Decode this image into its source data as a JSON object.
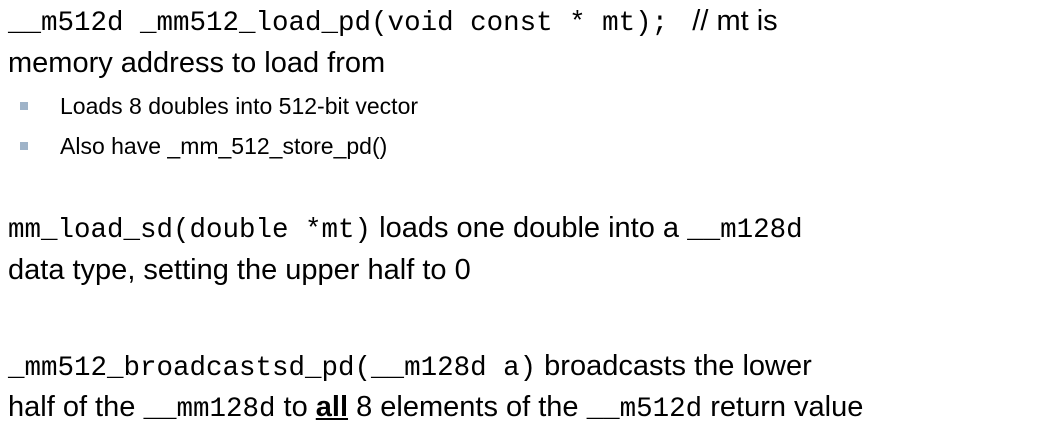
{
  "block1": {
    "code": "__m512d _mm512_load_pd(void const * mt);",
    "comment": "// mt is",
    "line2": "memory address to load from"
  },
  "bullets": [
    {
      "text": "Loads 8 doubles into 512-bit vector"
    },
    {
      "text": "Also have _mm_512_store_pd()"
    }
  ],
  "block2": {
    "code": "mm_load_sd(double *mt)",
    "text_after_code": "loads one double into a",
    "code2": "__m128d",
    "line2": "data type, setting the upper half to 0"
  },
  "block3": {
    "code": "_mm512_broadcastsd_pd(__m128d a)",
    "text_after_code": "broadcasts the lower",
    "line2_pre": "half of the",
    "code2": "__mm128d",
    "to_text": "to",
    "emph": "all",
    "line2_mid": "8 elements of the",
    "code3": "__m512d",
    "line2_end": "return value"
  },
  "colors": {
    "bullet": "#9fb3c8",
    "text": "#000000"
  }
}
